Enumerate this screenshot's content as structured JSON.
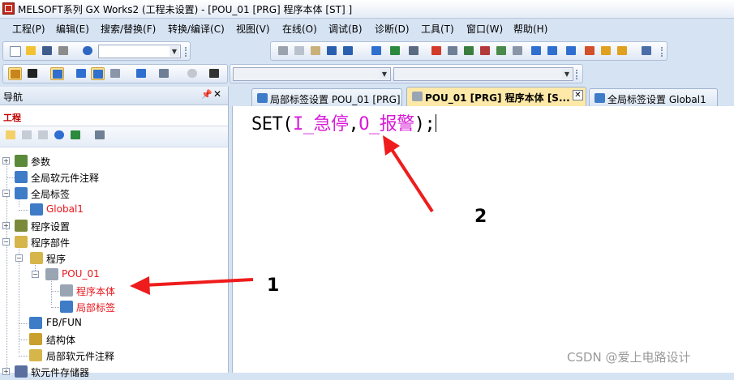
{
  "window": {
    "title": "MELSOFT系列 GX Works2 (工程未设置) - [POU_01 [PRG] 程序本体 [ST] ]"
  },
  "menu": [
    "工程(P)",
    "编辑(E)",
    "搜索/替换(F)",
    "转换/编译(C)",
    "视图(V)",
    "在线(O)",
    "调试(B)",
    "诊断(D)",
    "工具(T)",
    "窗口(W)",
    "帮助(H)"
  ],
  "navigation": {
    "title": "导航",
    "pin_icon": "pin-icon",
    "close_label": "✕",
    "section": "工程",
    "tree": [
      {
        "label": "参数",
        "red": false
      },
      {
        "label": "全局软元件注释",
        "red": false
      },
      {
        "label": "全局标签",
        "red": false
      },
      {
        "label": "Global1",
        "red": true
      },
      {
        "label": "程序设置",
        "red": false
      },
      {
        "label": "程序部件",
        "red": false
      },
      {
        "label": "程序",
        "red": false
      },
      {
        "label": "POU_01",
        "red": true
      },
      {
        "label": "程序本体",
        "red": true
      },
      {
        "label": "局部标签",
        "red": true
      },
      {
        "label": "FB/FUN",
        "red": false
      },
      {
        "label": "结构体",
        "red": false
      },
      {
        "label": "局部软元件注释",
        "red": false
      },
      {
        "label": "软元件存储器",
        "red": false
      }
    ]
  },
  "editor": {
    "tabs": [
      {
        "label": "局部标签设置 POU_01 [PRG]",
        "active": false
      },
      {
        "label": "POU_01 [PRG] 程序本体 [S...",
        "active": true
      },
      {
        "label": "全局标签设置 Global1",
        "active": false
      }
    ],
    "tab_close": "✕",
    "code": {
      "prefix": "SET(",
      "arg1": "I_急停",
      "comma": ",",
      "arg2": "O_报警",
      "suffix": ");"
    }
  },
  "annotations": {
    "callout1": "1",
    "callout2": "2",
    "color": "#ee1c1c"
  },
  "watermark": "CSDN @爱上电路设计"
}
